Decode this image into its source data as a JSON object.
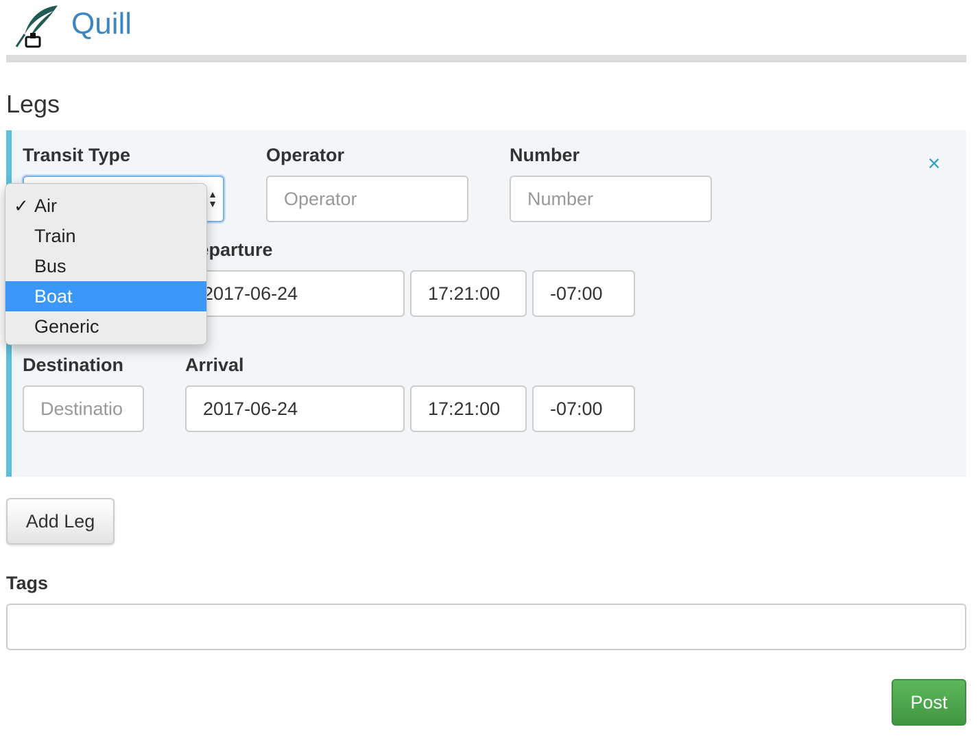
{
  "app": {
    "title": "Quill",
    "logo_icon": "quill-pen-icon"
  },
  "legs": {
    "title": "Legs",
    "close_label": "×",
    "transit_type": {
      "label": "Transit Type",
      "selected": "Air",
      "options": [
        "Air",
        "Train",
        "Bus",
        "Boat",
        "Generic"
      ],
      "highlighted": "Boat"
    },
    "operator": {
      "label": "Operator",
      "placeholder": "Operator",
      "value": ""
    },
    "number": {
      "label": "Number",
      "placeholder": "Number",
      "value": ""
    },
    "departure": {
      "label": "Departure",
      "date": "2017-06-24",
      "time": "17:21:00",
      "tz": "-07:00"
    },
    "destination": {
      "label": "Destination",
      "placeholder": "Destinatio",
      "value": ""
    },
    "arrival": {
      "label": "Arrival",
      "date": "2017-06-24",
      "time": "17:21:00",
      "tz": "-07:00"
    },
    "add_leg_label": "Add Leg"
  },
  "tags": {
    "label": "Tags",
    "value": ""
  },
  "post_label": "Post",
  "colors": {
    "brand": "#3a87c4",
    "accent": "#5bc0de",
    "highlight": "#3b98f8",
    "post": "#5cb85c"
  }
}
